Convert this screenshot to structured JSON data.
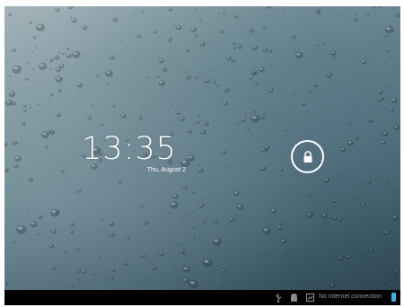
{
  "lockscreen": {
    "time": "13:35",
    "date": "Thu, August 2"
  },
  "statusbar": {
    "connection_text": "No internet connection",
    "icons": [
      "usb-icon",
      "android-debug-icon",
      "screenshot-notification-icon",
      "battery-icon"
    ]
  },
  "colors": {
    "battery": "#33b5e5",
    "status_text": "#9a9a9a"
  }
}
